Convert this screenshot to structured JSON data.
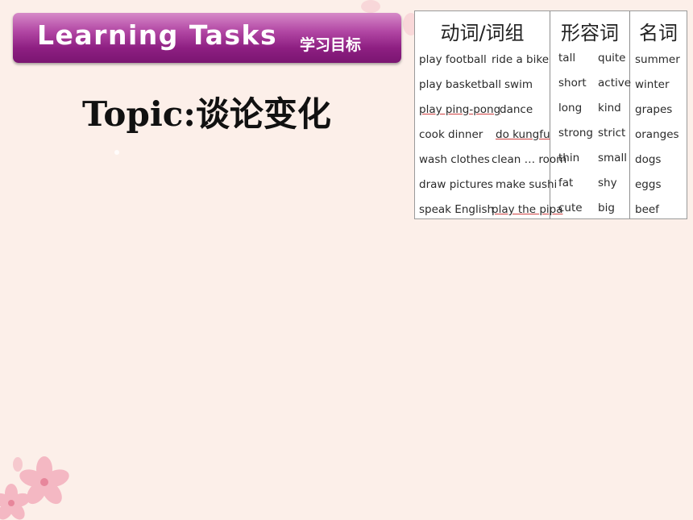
{
  "banner": {
    "title": "Learning Tasks",
    "subtitle": "学习目标"
  },
  "topic": "Topic:谈论变化",
  "vocab_table": {
    "headers": [
      "动词/词组",
      "形容词",
      "名词"
    ],
    "verbs_col1": [
      "play football",
      "play basketball",
      "play ping-pong",
      "cook dinner",
      "wash clothes",
      "draw pictures",
      "speak English"
    ],
    "verbs_col2": [
      "ride a bike",
      "swim",
      "dance",
      "do kungfu",
      "clean … room",
      "make sushi",
      "play the pipa"
    ],
    "adj_col1": [
      "tall",
      "short",
      "long",
      "strong",
      "thin",
      "fat",
      "cute"
    ],
    "adj_col2": [
      "quite",
      "active",
      "kind",
      "strict",
      "small",
      "shy",
      "big"
    ],
    "nouns": [
      "summer",
      "winter",
      "grapes",
      "oranges",
      "dogs",
      "eggs",
      "beef"
    ]
  },
  "colors": {
    "banner": "#a23597",
    "background": "#fcefe9",
    "blossom": "#f2a9b6"
  }
}
